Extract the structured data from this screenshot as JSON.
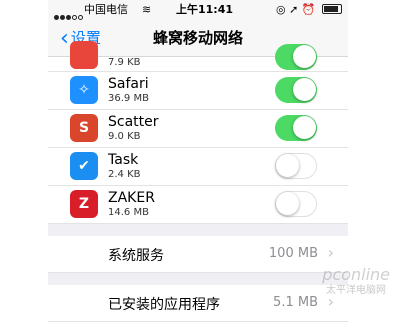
{
  "status_bar": {
    "carrier": "中国电信",
    "wifi_icon": "wifi-icon",
    "time": "上午11:41",
    "right_icons": "◎ ➚ ⏰"
  },
  "nav": {
    "back_label": "设置",
    "title": "蜂窝移动网络"
  },
  "apps": [
    {
      "name": "",
      "size": "7.9 KB",
      "icon": "app-icon-red",
      "icon_color": "#e8463a",
      "icon_glyph": "",
      "enabled": true
    },
    {
      "name": "Safari",
      "size": "36.9 MB",
      "icon": "compass-icon",
      "icon_color": "#1e90ff",
      "icon_glyph": "✧",
      "enabled": true
    },
    {
      "name": "Scatter",
      "size": "9.0 KB",
      "icon": "scatter-icon",
      "icon_color": "#d9462b",
      "icon_glyph": "S",
      "enabled": true
    },
    {
      "name": "Task",
      "size": "2.4 KB",
      "icon": "checkmark-icon",
      "icon_color": "#1b8ef2",
      "icon_glyph": "✔",
      "enabled": false
    },
    {
      "name": "ZAKER",
      "size": "14.6 MB",
      "icon": "zaker-icon",
      "icon_color": "#d81e28",
      "icon_glyph": "Z",
      "enabled": false
    }
  ],
  "settings": [
    {
      "label": "系统服务",
      "value": "100 MB",
      "chevron": "›"
    },
    {
      "label": "已安装的应用程序",
      "value": "5.1 MB",
      "chevron": "›"
    }
  ],
  "watermark": {
    "main": "pconline",
    "sub": "太平洋电脑网"
  },
  "colors": {
    "accent": "#007aff",
    "toggle_on": "#4cd964"
  }
}
